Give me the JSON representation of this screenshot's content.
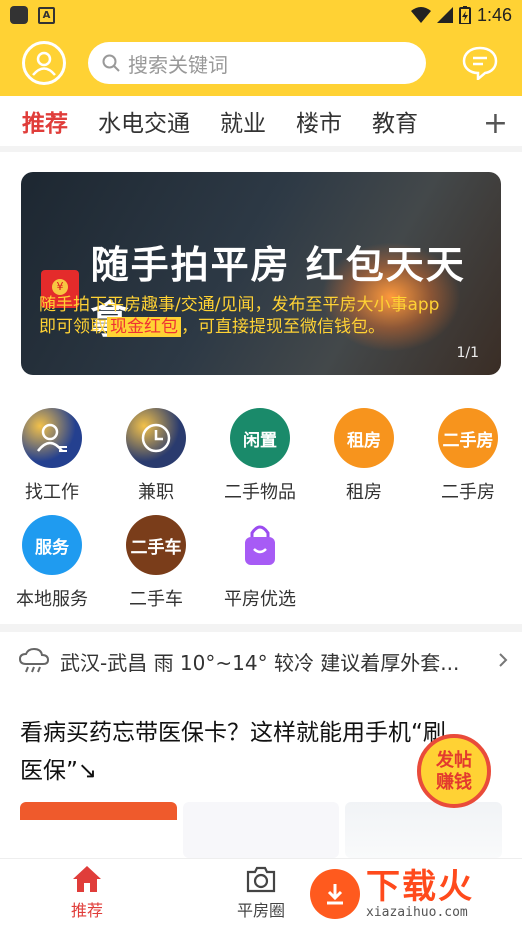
{
  "status_bar": {
    "time": "1:46",
    "badge": "A"
  },
  "header": {
    "search_placeholder": "搜索关键词",
    "accent": "#ffd234"
  },
  "tabs": [
    {
      "label": "推荐",
      "active": true
    },
    {
      "label": "水电交通"
    },
    {
      "label": "就业"
    },
    {
      "label": "楼市"
    },
    {
      "label": "教育"
    }
  ],
  "tab_add": "+",
  "banner": {
    "title": "随手拍平房 红包天天拿",
    "line1": "随手拍下平房趣事/交通/见闻，发布至平房大小事app",
    "line2_pre": "即可领取",
    "line2_highlight": "现金红包",
    "line2_post": "，可直接提现至微信钱包。",
    "page": "1/1"
  },
  "grid": [
    {
      "label": "找工作",
      "icon": "person-id-icon",
      "color": "#24408f",
      "text": ""
    },
    {
      "label": "兼职",
      "icon": "clock-icon",
      "color": "#2a3b6e",
      "text": ""
    },
    {
      "label": "二手物品",
      "icon": "tag",
      "color": "#1a8a6a",
      "text": "闲置"
    },
    {
      "label": "租房",
      "icon": "tag",
      "color": "#f7941d",
      "text": "租房"
    },
    {
      "label": "二手房",
      "icon": "tag",
      "color": "#f7941d",
      "text": "二手房"
    },
    {
      "label": "本地服务",
      "icon": "tag",
      "color": "#1f9bf0",
      "text": "服务"
    },
    {
      "label": "二手车",
      "icon": "tag",
      "color": "#7a3d1a",
      "text": "二手车"
    },
    {
      "label": "平房优选",
      "icon": "shopping-bag-icon",
      "color": "#ffffff",
      "text": ""
    }
  ],
  "weather": {
    "text": "武汉-武昌 雨 10°~14° 较冷 建议着厚外套...",
    "icon": "cloud-rain-icon"
  },
  "article": {
    "title": "看病买药忘带医保卡？这样就能用手机“刷医保”↘"
  },
  "fab": {
    "line1": "发帖",
    "line2": "赚钱"
  },
  "bottom_nav": [
    {
      "label": "推荐",
      "icon": "home-icon",
      "active": true
    },
    {
      "label": "平房圈",
      "icon": "camera-icon"
    }
  ],
  "watermark": {
    "big": "下载火",
    "small": "xiazaihuo.com"
  }
}
